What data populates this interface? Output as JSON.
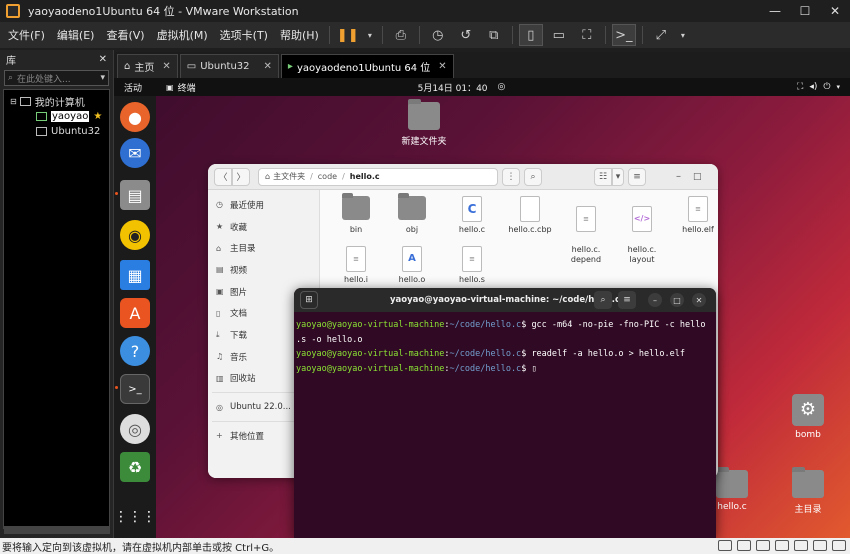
{
  "window": {
    "title": "yaoyaodeno1Ubuntu 64 位 - VMware Workstation"
  },
  "menubar": {
    "items": [
      "文件(F)",
      "编辑(E)",
      "查看(V)",
      "虚拟机(M)",
      "选项卡(T)",
      "帮助(H)"
    ]
  },
  "library": {
    "title": "库",
    "search_placeholder": "在此处键入...",
    "root": "我的计算机",
    "vms": [
      "yaoyao",
      "Ubuntu32"
    ]
  },
  "tabs": [
    {
      "label": "主页"
    },
    {
      "label": "Ubuntu32"
    },
    {
      "label": "yaoyaodeno1Ubuntu 64 位"
    }
  ],
  "ubuntu": {
    "activities": "活动",
    "app_name": "终端",
    "clock": "5月14日  01：40",
    "desktop": {
      "new_folder": "新建文件夹",
      "bomb": "bomb",
      "hello_c": "hello.c",
      "home": "主目录"
    }
  },
  "files": {
    "path": {
      "home": "主文件夹",
      "p1": "code",
      "current": "hello.c"
    },
    "sidebar": [
      {
        "icon": "clock-icon",
        "label": "最近使用"
      },
      {
        "icon": "star-icon",
        "label": "收藏"
      },
      {
        "icon": "home-icon",
        "label": "主目录"
      },
      {
        "icon": "video-icon",
        "label": "视频"
      },
      {
        "icon": "picture-icon",
        "label": "图片"
      },
      {
        "icon": "document-icon",
        "label": "文档"
      },
      {
        "icon": "download-icon",
        "label": "下载"
      },
      {
        "icon": "music-icon",
        "label": "音乐"
      },
      {
        "icon": "trash-icon",
        "label": "回收站"
      },
      {
        "icon": "drive-icon",
        "label": "Ubuntu 22.0..."
      },
      {
        "icon": "plus-icon",
        "label": "其他位置"
      }
    ],
    "items": [
      {
        "name": "bin",
        "type": "folder"
      },
      {
        "name": "obj",
        "type": "folder"
      },
      {
        "name": "hello.c",
        "type": "c"
      },
      {
        "name": "hello.c.cbp",
        "type": "blank"
      },
      {
        "name": "hello.c.\ndepend",
        "type": "text"
      },
      {
        "name": "hello.c.\nlayout",
        "type": "code"
      },
      {
        "name": "hello.elf",
        "type": "text"
      },
      {
        "name": "hello.i",
        "type": "text"
      },
      {
        "name": "hello.o",
        "type": "A"
      },
      {
        "name": "hello.s",
        "type": "text"
      }
    ]
  },
  "terminal": {
    "title": "yaoyao@yaoyao-virtual-machine: ~/code/hello.c",
    "lines": [
      {
        "user": "yaoyao@yaoyao-virtual-machine",
        "path": "~/code/hello.c",
        "cmd": "gcc -m64 -no-pie -fno-PIC -c hello"
      },
      {
        "user": "",
        "path": "",
        "cmd": ".s -o hello.o"
      },
      {
        "user": "yaoyao@yaoyao-virtual-machine",
        "path": "~/code/hello.c",
        "cmd": "readelf -a hello.o > hello.elf"
      },
      {
        "user": "yaoyao@yaoyao-virtual-machine",
        "path": "~/code/hello.c",
        "cmd": ""
      }
    ]
  },
  "statusbar": {
    "text": "要将输入定向到该虚拟机，请在虚拟机内部单击或按 Ctrl+G。"
  }
}
